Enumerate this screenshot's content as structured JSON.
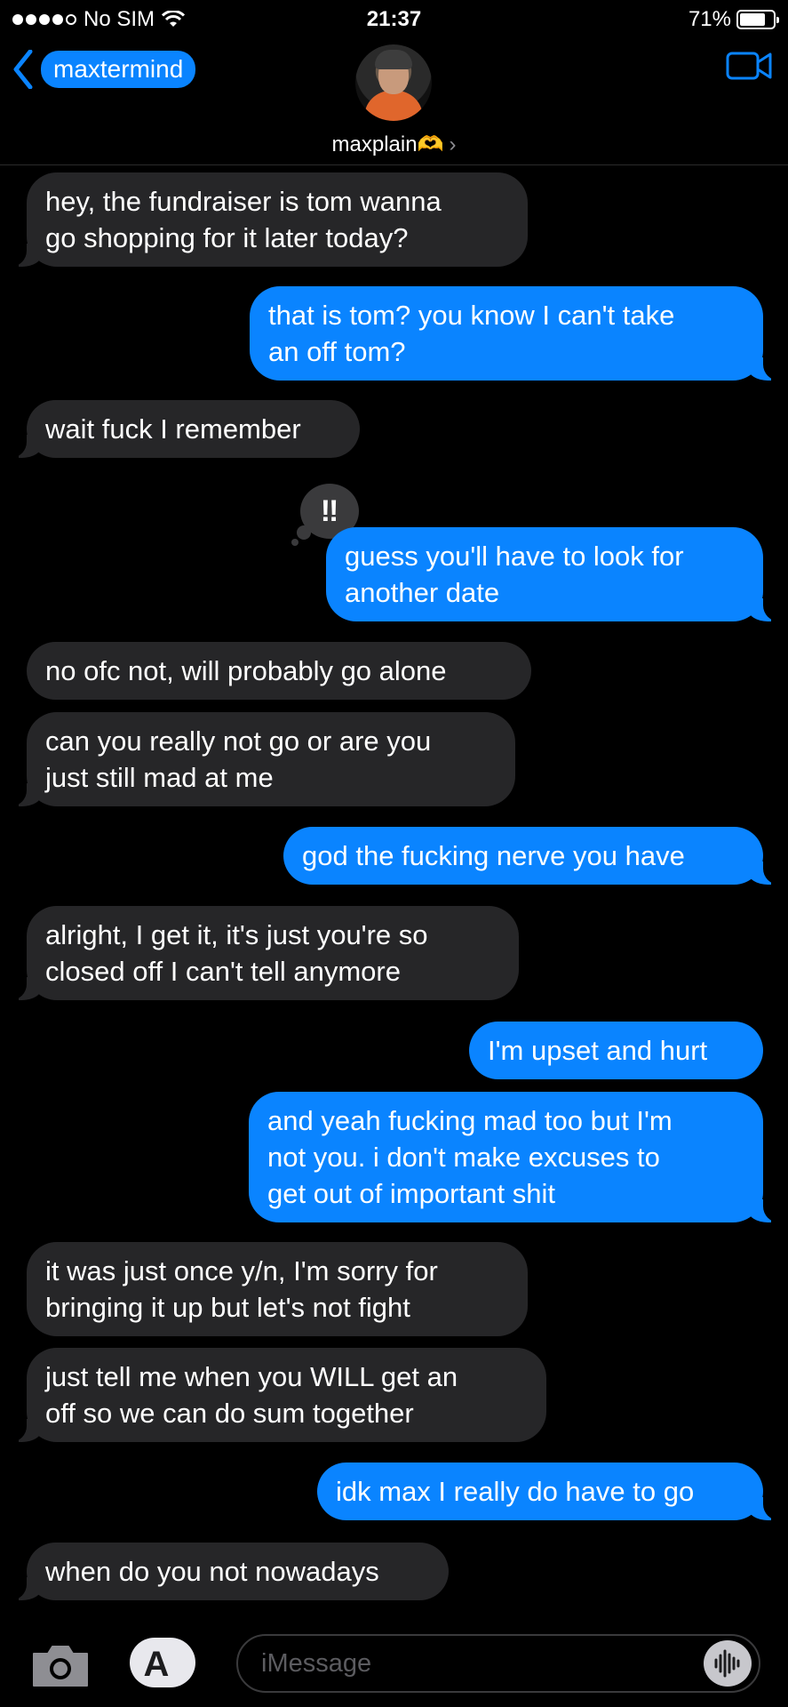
{
  "status": {
    "carrier": "No SIM",
    "time": "21:37",
    "battery": "71%",
    "battery_level": 0.71
  },
  "header": {
    "back_label": "maxtermind",
    "contact_name": "maxplain🫶"
  },
  "colors": {
    "outgoing": "#0a84ff",
    "incoming": "#262628",
    "background": "#000000"
  },
  "messages": [
    {
      "from": "them",
      "text": "hey, the fundraiser is tom wanna\ngo shopping for it later today?"
    },
    {
      "from": "me",
      "text": "that is tom? you know I can't take\nan off tom?"
    },
    {
      "from": "them",
      "text": "wait fuck I remember"
    },
    {
      "from": "me",
      "text": "guess you'll have to look for\nanother date",
      "tapback": "‼"
    },
    {
      "from": "them",
      "text": "no ofc not, will probably go alone"
    },
    {
      "from": "them",
      "text": "can you really not go or are you\njust still mad at me"
    },
    {
      "from": "me",
      "text": "god the fucking nerve you have"
    },
    {
      "from": "them",
      "text": "alright, I get it, it's just you're so\nclosed off I can't tell anymore"
    },
    {
      "from": "me",
      "text": "I'm upset and hurt"
    },
    {
      "from": "me",
      "text": "and yeah fucking mad too but I'm\nnot you. i don't make excuses to\nget out of important shit"
    },
    {
      "from": "them",
      "text": "it was just once y/n, I'm sorry for\nbringing it up but let's not fight"
    },
    {
      "from": "them",
      "text": "just tell me when you WILL get an\noff so we can do sum together"
    },
    {
      "from": "me",
      "text": "idk max I really do have to go"
    },
    {
      "from": "them",
      "text": "when do you not nowadays"
    }
  ],
  "composer": {
    "placeholder": "iMessage"
  },
  "icons": [
    "signal-dots-icon",
    "wifi-icon",
    "battery-icon",
    "back-chevron-icon",
    "video-call-icon",
    "camera-icon",
    "app-store-icon",
    "audio-waveform-icon"
  ]
}
